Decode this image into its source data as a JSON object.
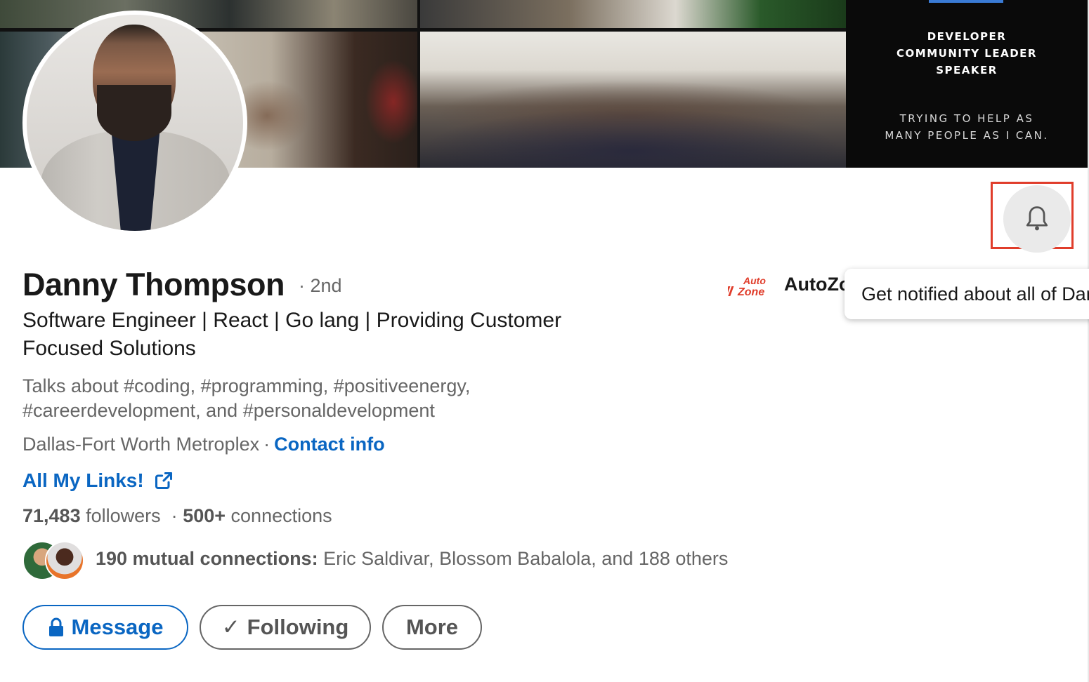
{
  "banner": {
    "lines": [
      "DEVELOPER",
      "COMMUNITY LEADER",
      "SPEAKER"
    ],
    "sublines": [
      "TRYING TO HELP AS",
      "MANY PEOPLE AS I CAN."
    ]
  },
  "profile": {
    "name": "Danny Thompson",
    "degree": "· 2nd",
    "headline": "Software Engineer | React | Go lang | Providing Customer Focused Solutions",
    "talks_about": "Talks about #coding, #programming, #positiveenergy, #careerdevelopment, and #personaldevelopment",
    "location": "Dallas-Fort Worth Metroplex",
    "location_sep": "·",
    "contact_label": "Contact info",
    "link_label": "All My Links!",
    "followers_count": "71,483",
    "followers_label": "followers",
    "stats_sep": "·",
    "connections_count": "500+",
    "connections_label": "connections",
    "mutual_count": "190 mutual connections:",
    "mutual_names": "Eric Saldivar, Blossom Babalola, and 188 others"
  },
  "company": {
    "name": "AutoZone",
    "logo_text": [
      "Auto",
      "Zone"
    ],
    "logo_color": "#e03d2b"
  },
  "tooltip": {
    "text": "Get notified about all of Danny's posts"
  },
  "actions": {
    "message_label": "Message",
    "following_label": "Following",
    "following_check": "✓",
    "more_label": "More"
  },
  "colors": {
    "link_blue": "#0a66c2",
    "highlight_red": "#e03d2b"
  }
}
